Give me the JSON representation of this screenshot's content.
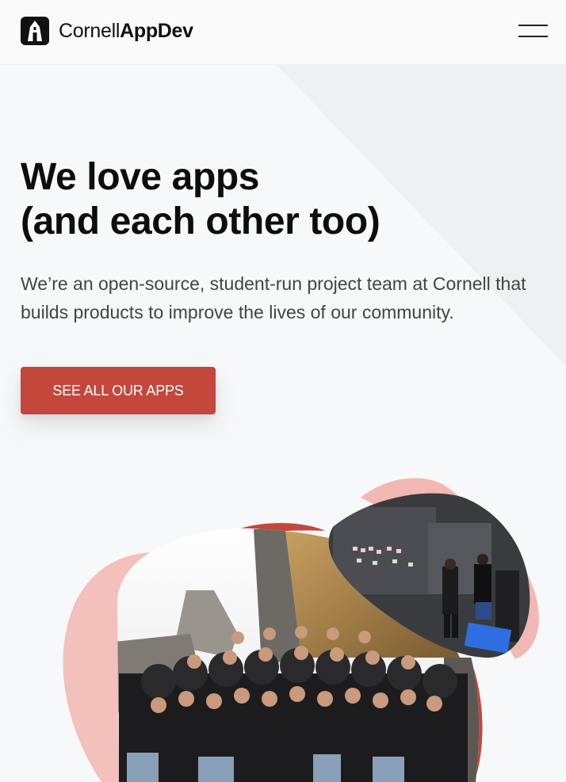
{
  "header": {
    "brand": {
      "name_light": "Cornell",
      "name_bold": "AppDev",
      "logo_icon": "clocktower-logo-icon"
    },
    "menu_icon": "hamburger-menu-icon"
  },
  "hero": {
    "title_line1": "We love apps",
    "title_line2": "(and each other too)",
    "subtitle": "We’re an open-source, student-run project team at Cornell that builds products to improve the lives of our community.",
    "cta_label": "SEE ALL OUR APPS"
  },
  "collage": {
    "photos": [
      {
        "name": "team-group-photo"
      },
      {
        "name": "team-working-at-whiteboard-photo"
      }
    ]
  },
  "colors": {
    "accent": "#c4473b",
    "blob_pink": "#f3b9b4",
    "background": "#f7f8fa",
    "diagonal_panel": "#eff0f3"
  }
}
